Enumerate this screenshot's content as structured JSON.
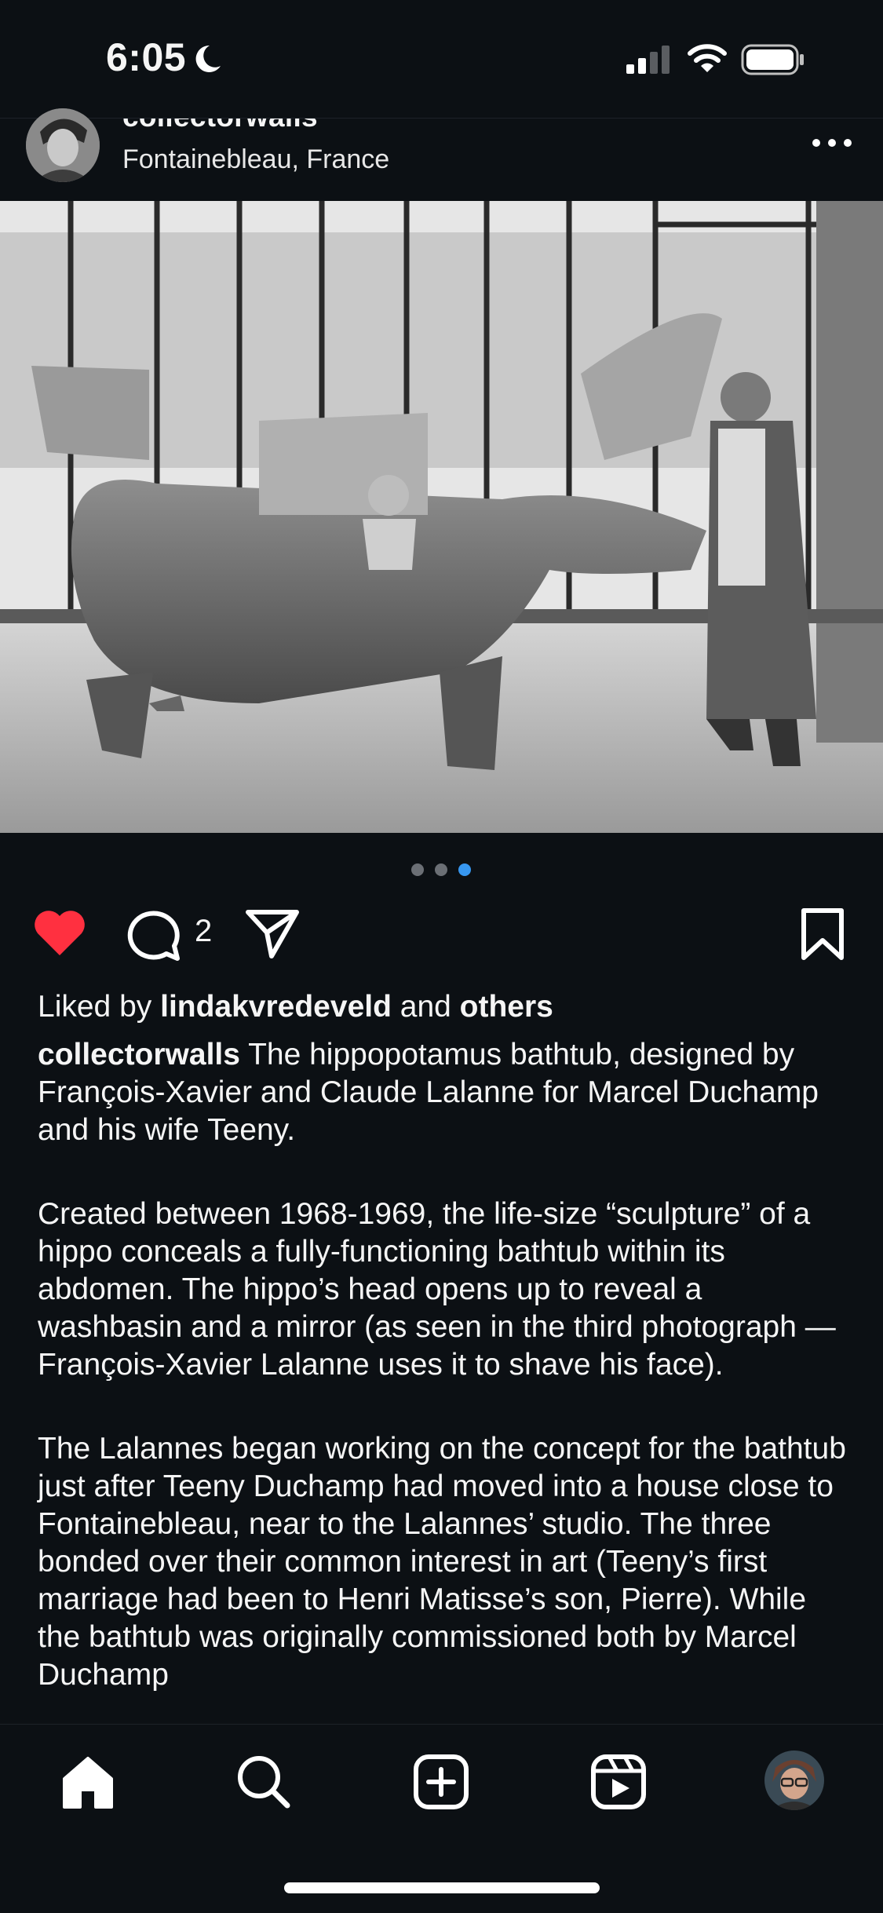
{
  "status_bar": {
    "time": "6:05",
    "icons": [
      "moon-icon",
      "cellular-signal-icon",
      "wifi-icon",
      "battery-icon"
    ]
  },
  "post": {
    "username": "collectorwalls",
    "location": "Fontainebleau, France",
    "carousel": {
      "total": 3,
      "active": 3
    },
    "comment_count": "2",
    "liked": true,
    "likes": {
      "prefix": "Liked by ",
      "user": "lindakvredeveld",
      "middle": " and ",
      "others": "others"
    },
    "caption": {
      "author": "collectorwalls",
      "p1": " The hippopotamus bathtub, designed by François-Xavier and Claude Lalanne for Marcel Duchamp and his wife Teeny.",
      "p2": "Created between 1968-1969, the life-size “sculpture” of a hippo conceals a fully-functioning bathtub within its abdomen. The hippo’s head opens up to reveal a washbasin and a mirror (as seen in the third photograph — François-Xavier Lalanne uses it to shave his face).",
      "p3": "The Lalannes began working on the concept for the bathtub just after Teeny Duchamp had moved into a house close to Fontainebleau, near to the Lalannes’ studio. The three bonded over their common interest in art (Teeny’s first marriage had been to Henri Matisse’s son, Pierre). While the bathtub was originally commissioned both by Marcel Duchamp"
    }
  },
  "colors": {
    "background": "#0c1014",
    "like_red": "#ff3040",
    "dot_active": "#3797f0",
    "dot_inactive": "#6b6f75"
  },
  "tab_bar": {
    "items": [
      "home-icon",
      "search-icon",
      "create-post-icon",
      "reels-icon",
      "profile-avatar"
    ]
  }
}
